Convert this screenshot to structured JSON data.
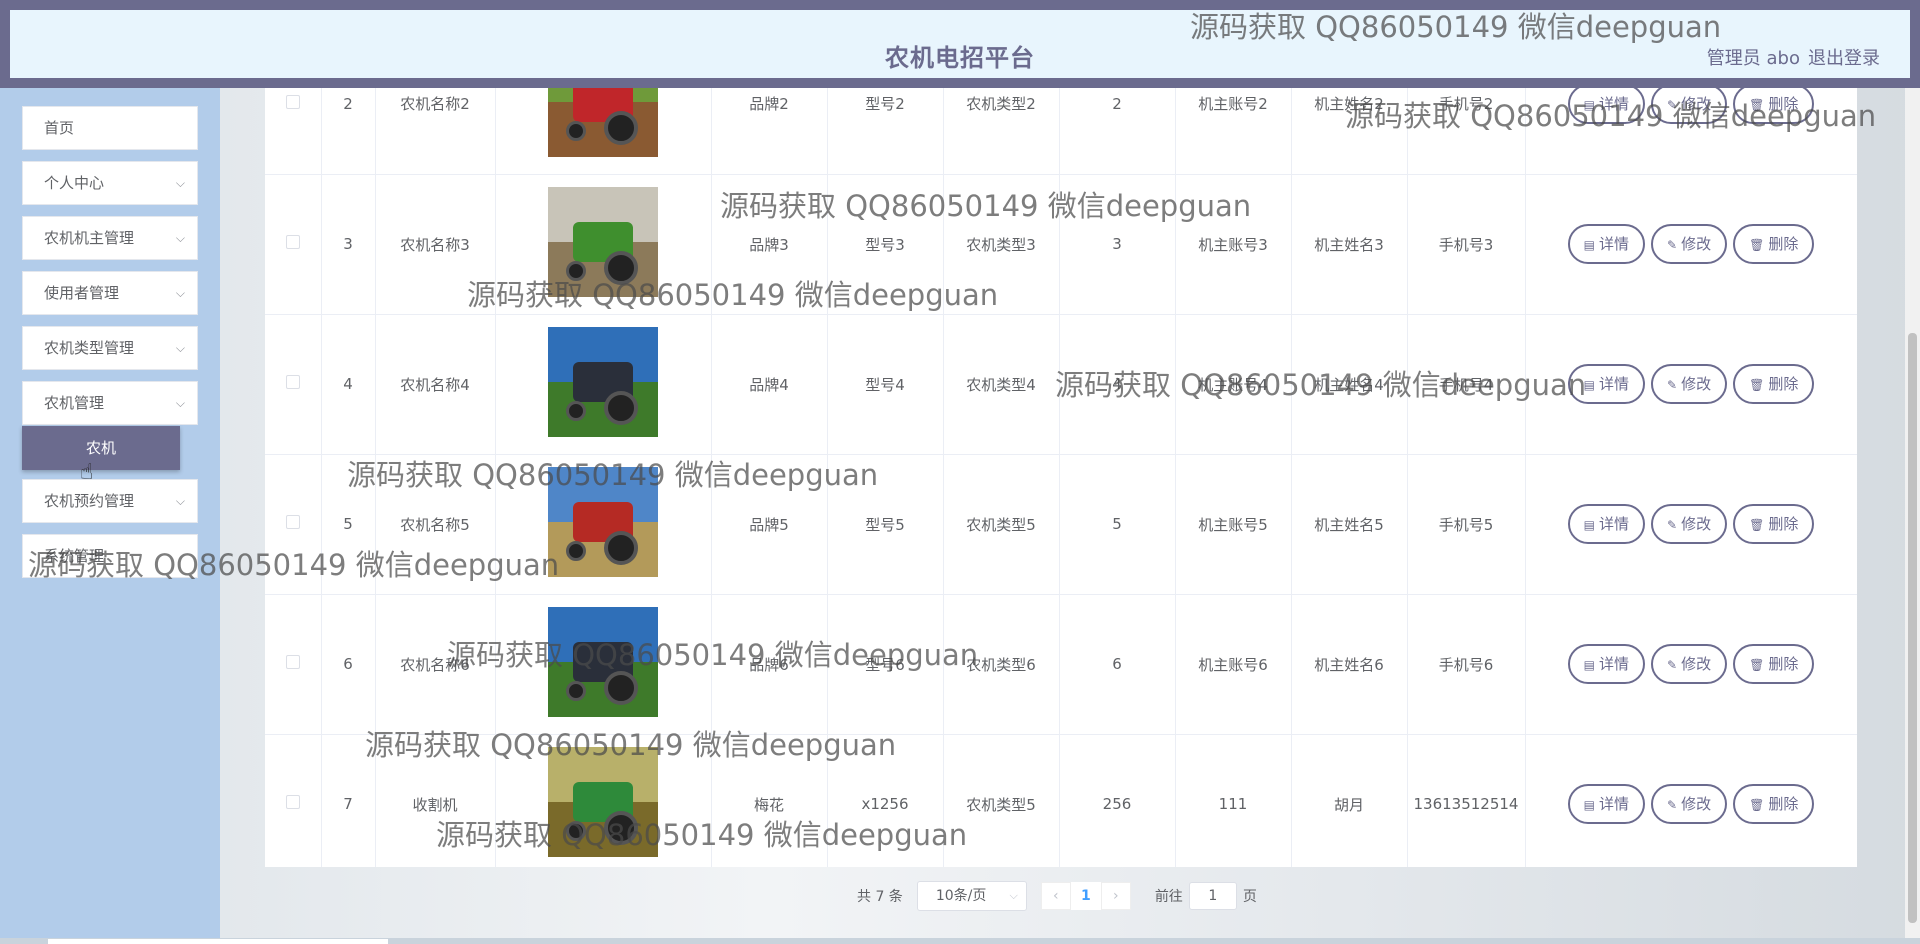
{
  "header": {
    "title": "农机电招平台",
    "user": "管理员 abo",
    "logout": "退出登录"
  },
  "sidebar": {
    "items": [
      {
        "label": "首页",
        "has_chevron": false
      },
      {
        "label": "个人中心",
        "has_chevron": true
      },
      {
        "label": "农机机主管理",
        "has_chevron": true
      },
      {
        "label": "使用者管理",
        "has_chevron": true
      },
      {
        "label": "农机类型管理",
        "has_chevron": true
      },
      {
        "label": "农机管理",
        "has_chevron": true
      },
      {
        "label": "农机预约管理",
        "has_chevron": true
      },
      {
        "label": "系统管理",
        "has_chevron": false
      }
    ],
    "submenu": {
      "label": "农机"
    }
  },
  "table": {
    "rows": [
      {
        "index": "2",
        "name": "农机名称2",
        "brand": "品牌2",
        "model": "型号2",
        "type": "农机类型2",
        "qty": "2",
        "account": "机主账号2",
        "owner": "机主姓名2",
        "phone": "手机号2",
        "image": "red-tractor"
      },
      {
        "index": "3",
        "name": "农机名称3",
        "brand": "品牌3",
        "model": "型号3",
        "type": "农机类型3",
        "qty": "3",
        "account": "机主账号3",
        "owner": "机主姓名3",
        "phone": "手机号3",
        "image": "green-tractor"
      },
      {
        "index": "4",
        "name": "农机名称4",
        "brand": "品牌4",
        "model": "型号4",
        "type": "农机类型4",
        "qty": "4",
        "account": "机主账号4",
        "owner": "机主姓名4",
        "phone": "手机号4",
        "image": "blue-sky-tractor"
      },
      {
        "index": "5",
        "name": "农机名称5",
        "brand": "品牌5",
        "model": "型号5",
        "type": "农机类型5",
        "qty": "5",
        "account": "机主账号5",
        "owner": "机主姓名5",
        "phone": "手机号5",
        "image": "red-tractor-field"
      },
      {
        "index": "6",
        "name": "农机名称6",
        "brand": "品牌6",
        "model": "型号6",
        "type": "农机类型6",
        "qty": "6",
        "account": "机主账号6",
        "owner": "机主姓名6",
        "phone": "手机号6",
        "image": "blue-sky-tractor"
      },
      {
        "index": "7",
        "name": "收割机",
        "brand": "梅花",
        "model": "x1256",
        "type": "农机类型5",
        "qty": "256",
        "account": "111",
        "owner": "胡月",
        "phone": "13613512514",
        "image": "harvester"
      }
    ],
    "actions": {
      "detail": "详情",
      "edit": "修改",
      "delete": "删除"
    }
  },
  "pagination": {
    "total": "共 7 条",
    "page_size": "10条/页",
    "current_page": "1",
    "goto_label": "前往",
    "goto_value": "1",
    "page_suffix": "页"
  },
  "watermark": {
    "text": "源码获取 QQ86050149 微信deepguan"
  },
  "colors": {
    "accent": "#6b6b8e",
    "sidebar_bg": "#b2ccea",
    "header_bg": "#e8f5fd"
  }
}
